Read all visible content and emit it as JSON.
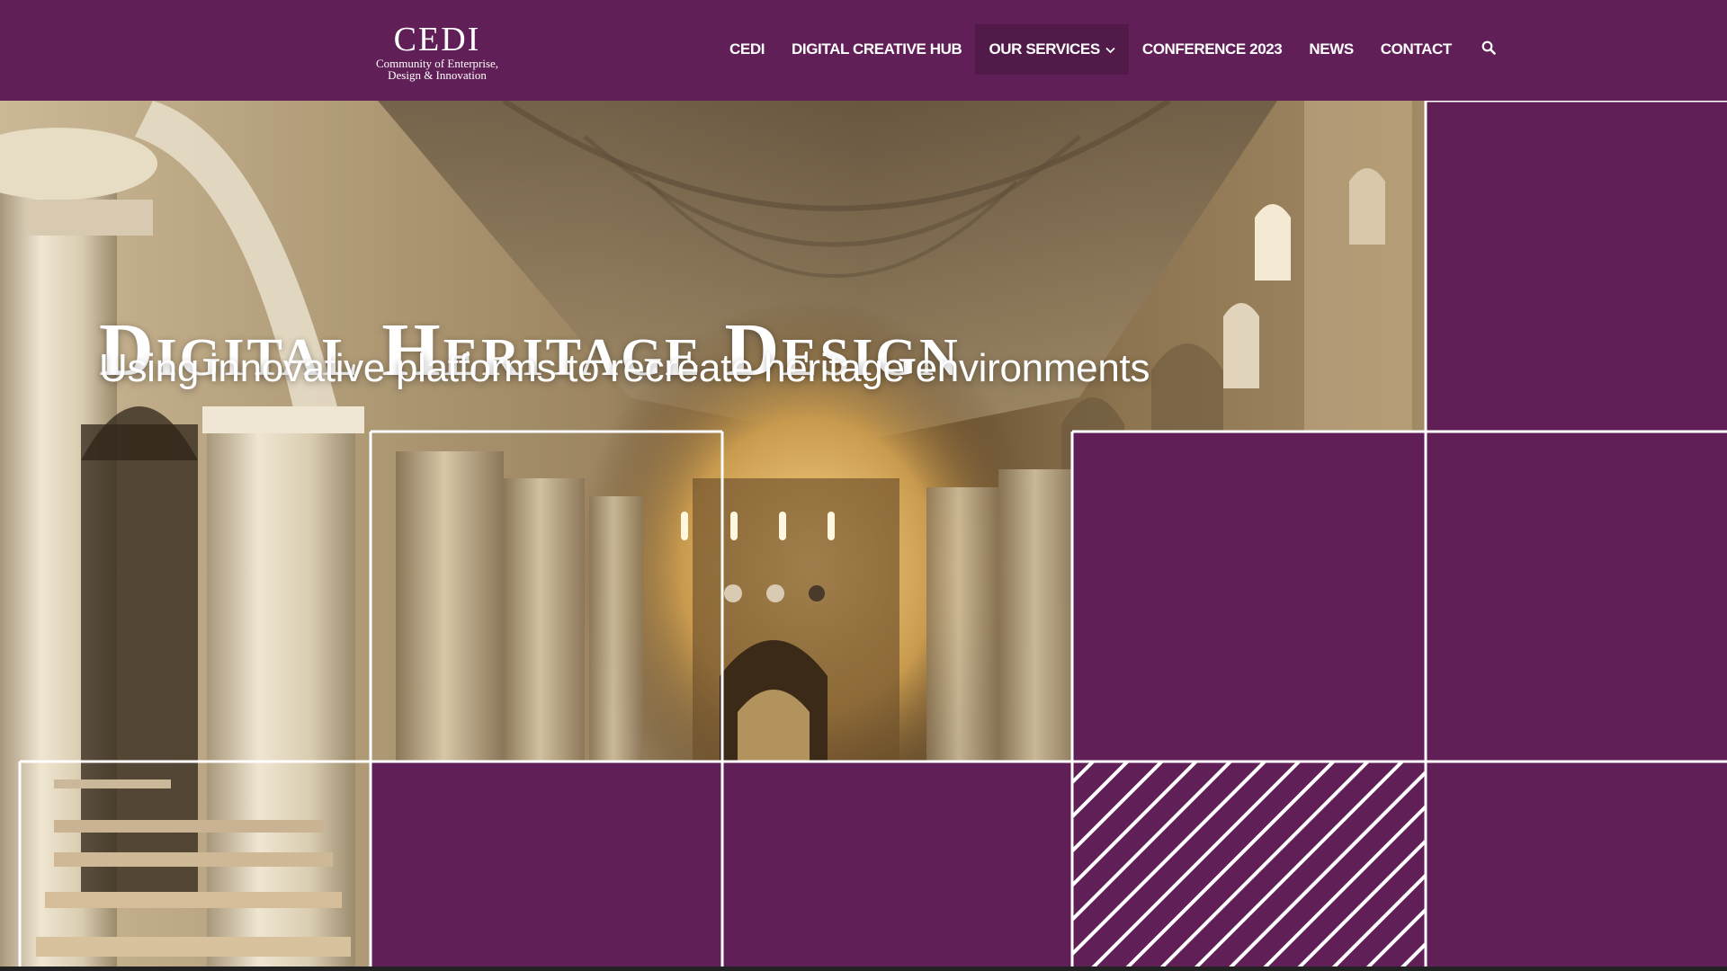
{
  "logo": {
    "mark": "CEDI",
    "tagline_line1": "Community of Enterprise,",
    "tagline_line2": "Design & Innovation"
  },
  "nav": {
    "items": [
      {
        "label": "CEDI"
      },
      {
        "label": "DIGITAL CREATIVE HUB"
      },
      {
        "label": "OUR SERVICES",
        "has_dropdown": true,
        "active": true
      },
      {
        "label": "CONFERENCE 2023"
      },
      {
        "label": "NEWS"
      },
      {
        "label": "CONTACT"
      }
    ],
    "search_icon": "search-icon"
  },
  "hero": {
    "title": "Digital Heritage Design",
    "subtitle": "Using innovative platforms to recreate heritage environments",
    "background_image": "cathedral-nave-interior-render"
  },
  "colors": {
    "brand_purple": "#611f57",
    "nav_active": "#521a49",
    "grid_line": "#ffffff"
  }
}
